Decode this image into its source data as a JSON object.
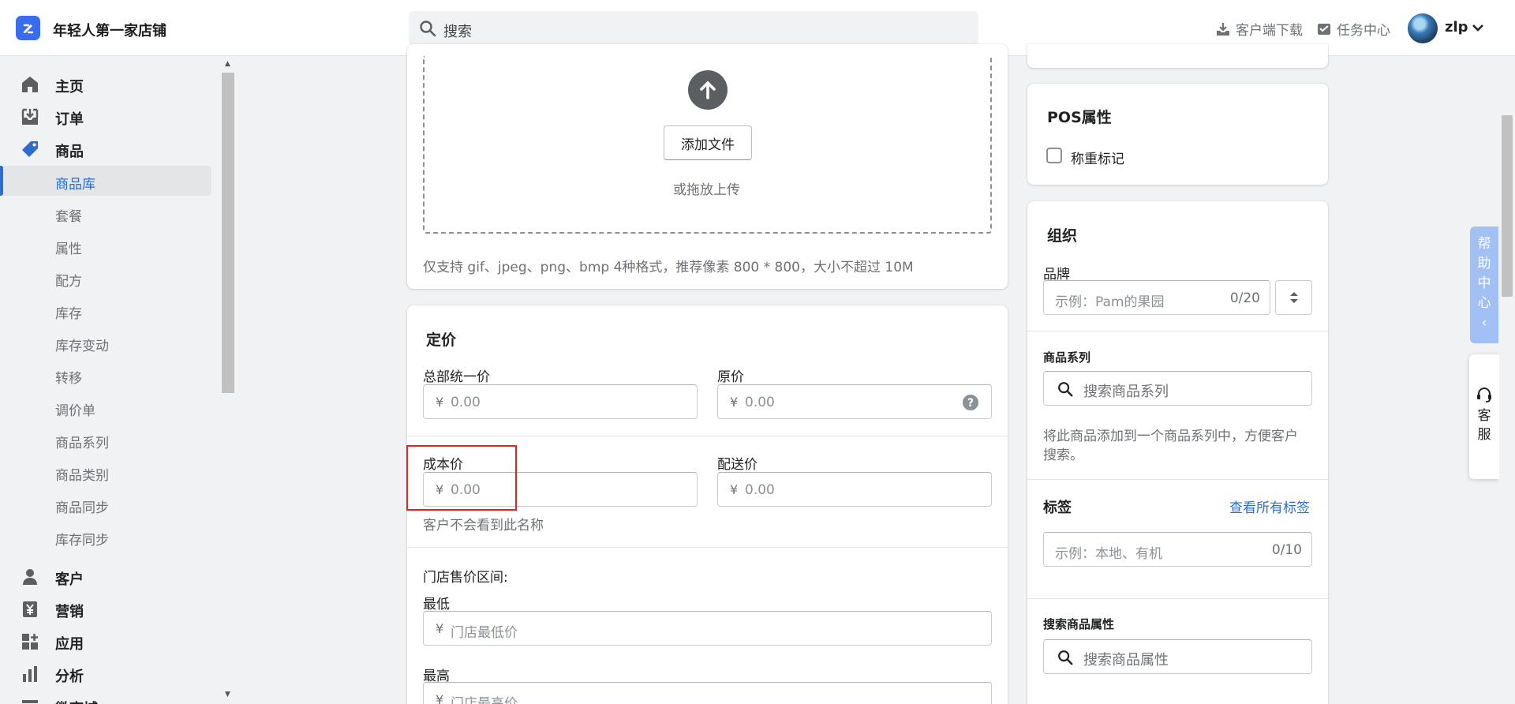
{
  "header": {
    "store_name": "年轻人第一家店铺",
    "search_placeholder": "搜索",
    "download_label": "客户端下载",
    "tasks_label": "任务中心",
    "user_name": "zlp"
  },
  "sidebar": {
    "items": [
      {
        "label": "主页",
        "icon": "home-icon"
      },
      {
        "label": "订单",
        "icon": "order-download-icon"
      },
      {
        "label": "商品",
        "icon": "tag-icon"
      }
    ],
    "product_sub_items": [
      "商品库",
      "套餐",
      "属性",
      "配方",
      "库存",
      "库存变动",
      "转移",
      "调价单",
      "商品系列",
      "商品类别",
      "商品同步",
      "库存同步"
    ],
    "active_sub_item": "商品库",
    "bottom_items": [
      {
        "label": "客户",
        "icon": "person-icon"
      },
      {
        "label": "营销",
        "icon": "yuan-icon"
      },
      {
        "label": "应用",
        "icon": "apps-icon"
      },
      {
        "label": "分析",
        "icon": "bar-chart-icon"
      },
      {
        "label": "微商城",
        "icon": "store-icon"
      }
    ]
  },
  "media": {
    "add_file_label": "添加文件",
    "drag_hint": "或拖放上传",
    "format_hint": "仅支持 gif、jpeg、png、bmp 4种格式，推荐像素 800 * 800，大小不超过 10M"
  },
  "pricing": {
    "title": "定价",
    "currency": "¥",
    "unified_price_label": "总部统一价",
    "unified_price_placeholder": "0.00",
    "original_price_label": "原价",
    "original_price_placeholder": "0.00",
    "cost_price_label": "成本价",
    "cost_price_placeholder": "0.00",
    "delivery_price_label": "配送价",
    "delivery_price_placeholder": "0.00",
    "cost_hint": "客户不会看到此名称",
    "store_range_label": "门店售价区间:",
    "min_label": "最低",
    "min_placeholder": "门店最低价",
    "max_label": "最高",
    "max_placeholder": "门店最高价"
  },
  "pos": {
    "title": "POS属性",
    "weigh_label": "称重标记"
  },
  "organization": {
    "title": "组织",
    "brand_label": "品牌",
    "brand_placeholder": "示例：Pam的果园",
    "brand_counter": "0/20",
    "series_label": "商品系列",
    "series_placeholder": "搜索商品系列",
    "series_hint_line1": "将此商品添加到一个商品系列中，方便客户",
    "series_hint_line2": "搜索。",
    "tags_label": "标签",
    "view_all_tags": "查看所有标签",
    "tags_placeholder": "示例：本地、有机",
    "tags_counter": "0/10",
    "attr_label": "搜索商品属性",
    "attr_placeholder": "搜索商品属性"
  },
  "floating": {
    "help_chars": [
      "帮",
      "助",
      "中",
      "心",
      "‹"
    ],
    "service_chars": [
      "客",
      "服"
    ]
  },
  "colors": {
    "accent": "#2c6ecb",
    "logo": "#3b6cf0",
    "highlight": "#e02424",
    "help_tab": "#a3c0f5"
  }
}
